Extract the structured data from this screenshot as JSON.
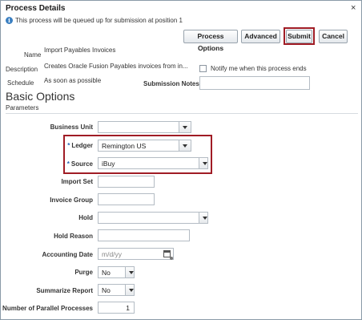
{
  "dialog": {
    "title": "Process Details",
    "close_glyph": "×",
    "info_message": "This process will be queued up for submission at position 1"
  },
  "toolbar": {
    "process_options_label": "Process Options",
    "advanced_label": "Advanced",
    "submit_label": "Submit",
    "cancel_label": "Cancel"
  },
  "summary": {
    "name_label": "Name",
    "name_value": "Import Payables Invoices",
    "description_label": "Description",
    "description_value": "Creates Oracle Fusion Payables invoices from in...",
    "schedule_label": "Schedule",
    "schedule_value": "As soon as possible",
    "notify_label": "Notify me when this process ends",
    "notify_checked": false,
    "submission_notes_label": "Submission Notes",
    "submission_notes_value": ""
  },
  "basic_options": {
    "heading": "Basic Options",
    "subheading": "Parameters"
  },
  "params": {
    "business_unit": {
      "label": "Business Unit",
      "value": ""
    },
    "ledger": {
      "label": "Ledger",
      "value": "Remington US",
      "required": true
    },
    "source": {
      "label": "Source",
      "value": "iBuy",
      "required": true
    },
    "import_set": {
      "label": "Import Set",
      "value": ""
    },
    "invoice_group": {
      "label": "Invoice Group",
      "value": ""
    },
    "hold": {
      "label": "Hold",
      "value": ""
    },
    "hold_reason": {
      "label": "Hold Reason",
      "value": ""
    },
    "accounting_date": {
      "label": "Accounting Date",
      "placeholder": "m/d/yy"
    },
    "purge": {
      "label": "Purge",
      "value": "No"
    },
    "summarize_report": {
      "label": "Summarize Report",
      "value": "No"
    },
    "parallel_processes": {
      "label": "Number of Parallel Processes",
      "value": "1"
    }
  },
  "colors": {
    "highlight": "#a01c25",
    "required_marker": "#2864b4",
    "info_icon": "#3a7fc1"
  },
  "icons": {
    "info": "info-icon",
    "close": "close-icon",
    "dropdown": "chevron-down-icon",
    "calendar": "calendar-icon"
  }
}
